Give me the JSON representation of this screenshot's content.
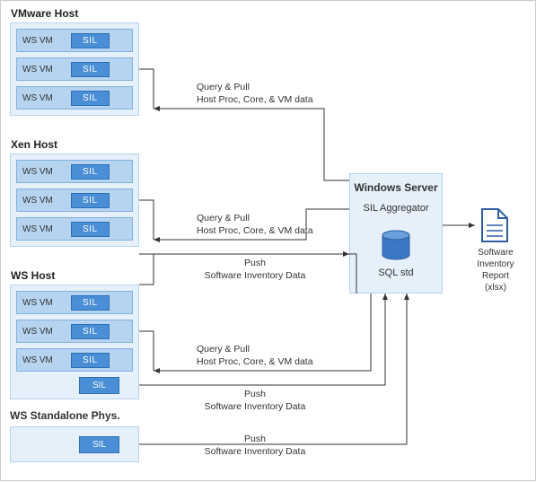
{
  "hosts": [
    {
      "title": "VMware Host",
      "vms": [
        "WS VM",
        "WS VM",
        "WS VM"
      ]
    },
    {
      "title": "Xen Host",
      "vms": [
        "WS VM",
        "WS VM",
        "WS VM"
      ]
    },
    {
      "title": "WS Host",
      "vms": [
        "WS VM",
        "WS VM",
        "WS VM"
      ]
    }
  ],
  "sil_label": "SIL",
  "standalone_title": "WS Standalone Phys.",
  "server": {
    "title": "Windows Server",
    "subtitle": "SIL Aggregator",
    "db_label": "SQL std"
  },
  "report": {
    "line1": "Software",
    "line2": "Inventory Report",
    "line3": "(xlsx)"
  },
  "flows": {
    "query_pull_title": "Query & Pull",
    "query_pull_desc": "Host Proc, Core, & VM data",
    "push_title": "Push",
    "push_desc": "Software Inventory Data"
  },
  "chart_data": {
    "type": "diagram",
    "title": "Software Inventory Logging (SIL) architecture",
    "nodes": [
      {
        "id": "vmware-host",
        "label": "VMware Host",
        "children": [
          "WS VM + SIL",
          "WS VM + SIL",
          "WS VM + SIL"
        ]
      },
      {
        "id": "xen-host",
        "label": "Xen Host",
        "children": [
          "WS VM + SIL",
          "WS VM + SIL",
          "WS VM + SIL"
        ]
      },
      {
        "id": "ws-host",
        "label": "WS Host",
        "children": [
          "WS VM + SIL",
          "WS VM + SIL",
          "WS VM + SIL",
          "SIL (host)"
        ]
      },
      {
        "id": "ws-standalone",
        "label": "WS Standalone Phys.",
        "children": [
          "SIL"
        ]
      },
      {
        "id": "windows-server",
        "label": "Windows Server",
        "sub": "SIL Aggregator",
        "contains": "SQL std"
      },
      {
        "id": "report",
        "label": "Software Inventory Report (xlsx)"
      }
    ],
    "edges": [
      {
        "from": "windows-server",
        "to": "vmware-host",
        "direction": "to-host",
        "label": "Query & Pull — Host Proc, Core, & VM data"
      },
      {
        "from": "windows-server",
        "to": "xen-host",
        "direction": "to-host",
        "label": "Query & Pull — Host Proc, Core, & VM data"
      },
      {
        "from": "windows-server",
        "to": "ws-host",
        "direction": "to-host",
        "label": "Query & Pull — Host Proc, Core, & VM data"
      },
      {
        "from": "xen-host.sil",
        "to": "windows-server",
        "direction": "to-server",
        "label": "Push — Software Inventory Data"
      },
      {
        "from": "ws-host.sil-host",
        "to": "windows-server",
        "direction": "to-server",
        "label": "Push — Software Inventory Data"
      },
      {
        "from": "ws-standalone.sil",
        "to": "windows-server",
        "direction": "to-server",
        "label": "Push — Software Inventory Data"
      },
      {
        "from": "windows-server",
        "to": "report",
        "direction": "output",
        "label": ""
      }
    ]
  }
}
